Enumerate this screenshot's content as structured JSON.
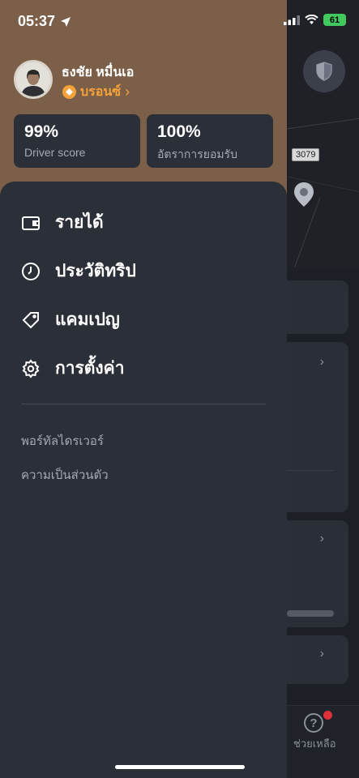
{
  "status_bar": {
    "time": "05:37",
    "battery": "61"
  },
  "profile": {
    "name": "ธงชัย หมื่นเอ",
    "tier": "บรอนซ์"
  },
  "stats": [
    {
      "value": "99%",
      "label": "Driver score"
    },
    {
      "value": "100%",
      "label": "อัตราการยอมรับ"
    }
  ],
  "menu": {
    "items": [
      {
        "label": "รายได้",
        "icon": "wallet-icon"
      },
      {
        "label": "ประวัติทริป",
        "icon": "clock-icon"
      },
      {
        "label": "แคมเปญ",
        "icon": "tag-icon"
      },
      {
        "label": "การตั้งค่า",
        "icon": "gear-icon"
      }
    ],
    "links": [
      "พอร์ทัลไดรเวอร์",
      "ความเป็นส่วนตัว"
    ]
  },
  "background": {
    "road_number": "3079",
    "help_label": "ช่วยเหลือ"
  },
  "colors": {
    "header": "#7c5f48",
    "drawer": "#2b2f38",
    "tier": "#f5a23a",
    "battery": "#42c95e",
    "notification": "#e0303a"
  }
}
